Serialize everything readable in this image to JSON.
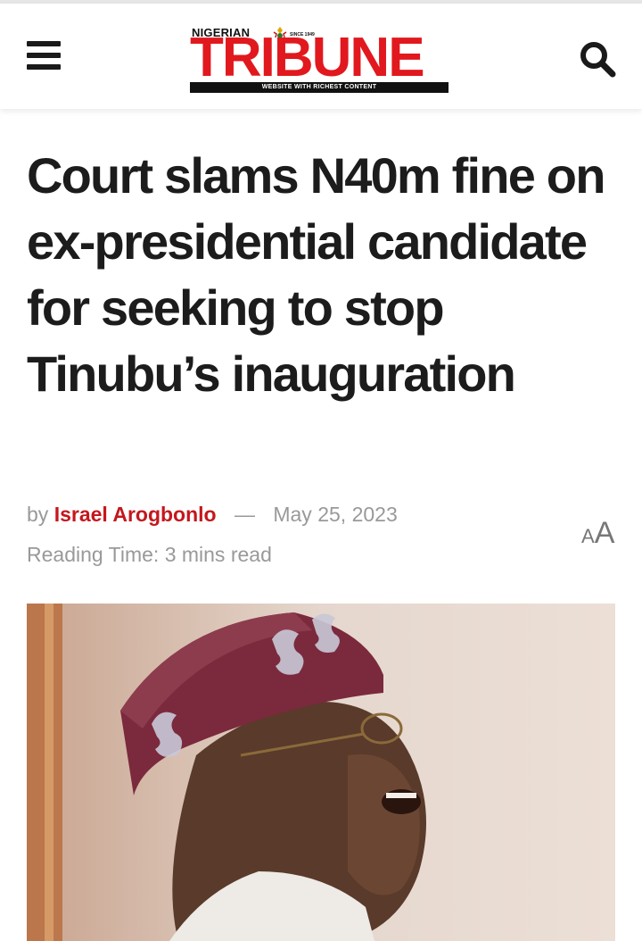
{
  "logo": {
    "small_text": "NIGERIAN",
    "since_text": "SINCE 1949",
    "main_text": "TRIBUNE",
    "tagline": "WEBSITE WITH RICHEST CONTENT",
    "brand_color": "#e1181e"
  },
  "header": {
    "menu_icon": "hamburger-menu-icon",
    "search_icon": "search-icon"
  },
  "article": {
    "headline": "Court slams N40m fine on ex-presidential candidate for seeking to stop Tinubu’s inauguration",
    "by_label": "by",
    "author": "Israel Arogbonlo",
    "separator": "—",
    "date": "May 25, 2023",
    "reading_time": "Reading Time: 3 mins read",
    "font_size_toggle_small": "A",
    "font_size_toggle_big": "A",
    "accent_color": "#c4171d"
  }
}
